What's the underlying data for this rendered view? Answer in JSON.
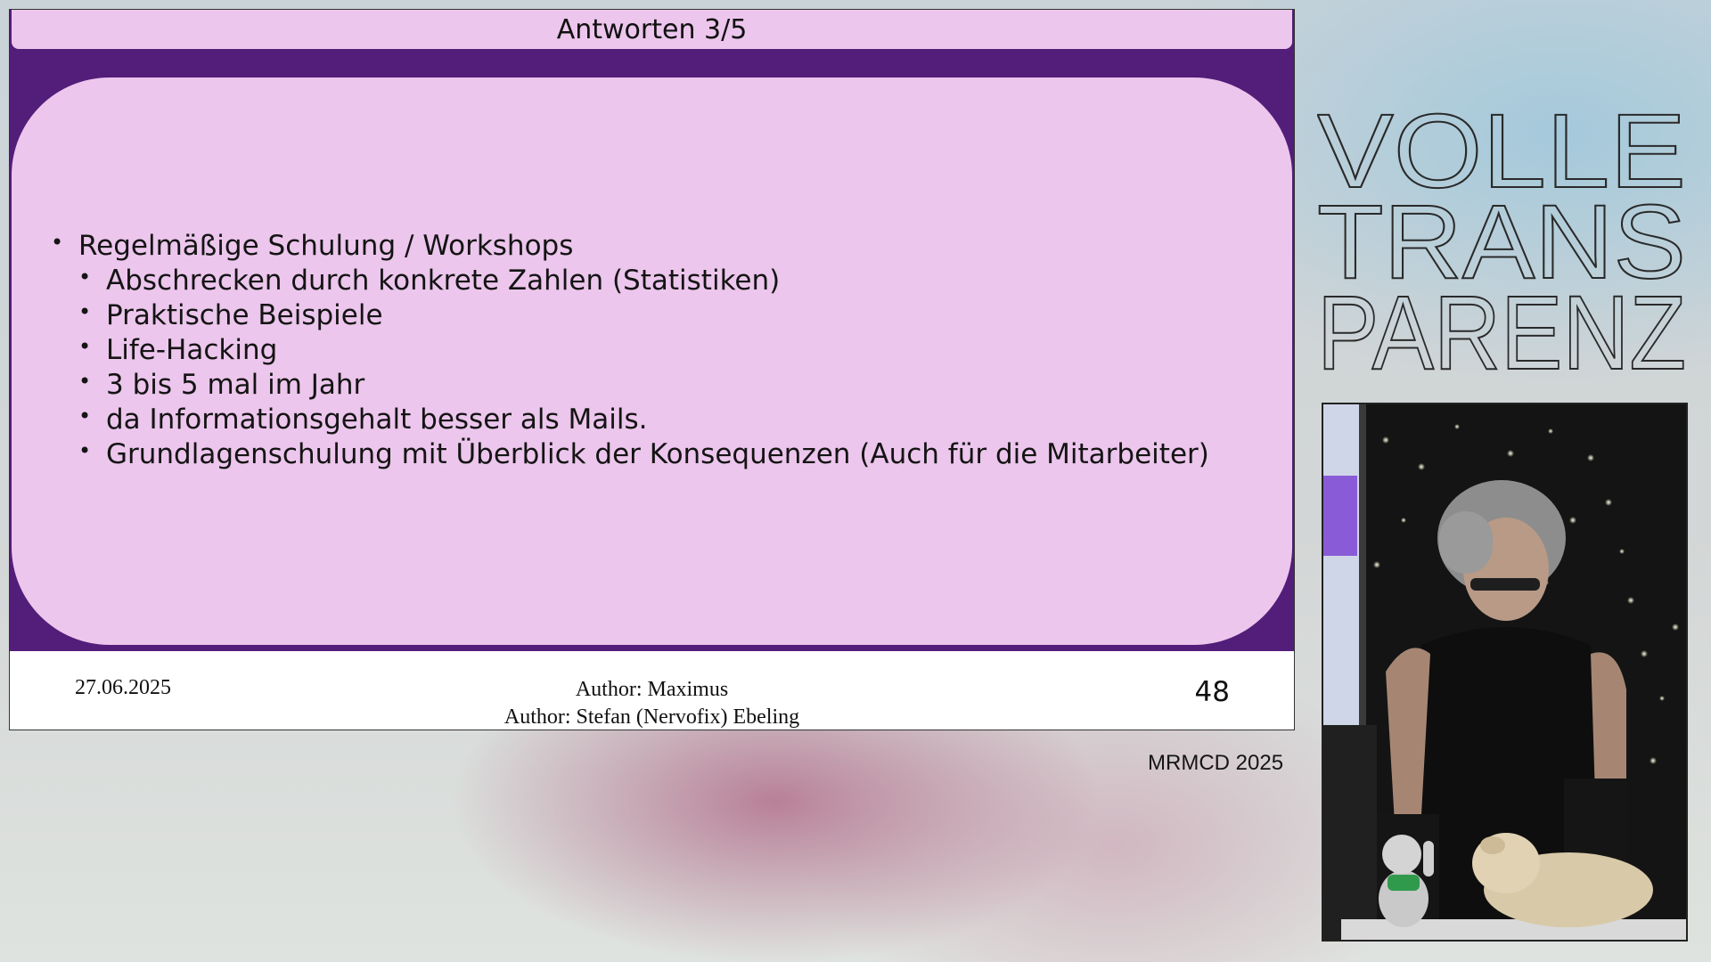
{
  "slide": {
    "title": "Antworten 3/5",
    "bullets": [
      {
        "level": 1,
        "text": "Regelmäßige Schulung / Workshops"
      },
      {
        "level": 2,
        "text": "Abschrecken durch konkrete Zahlen (Statistiken)"
      },
      {
        "level": 2,
        "text": "Praktische Beispiele"
      },
      {
        "level": 2,
        "text": "Life-Hacking"
      },
      {
        "level": 2,
        "text": "3 bis 5 mal im Jahr"
      },
      {
        "level": 2,
        "text": "da Informationsgehalt besser als Mails."
      },
      {
        "level": 2,
        "text": "Grundlagenschulung mit Überblick der Konsequenzen (Auch für die Mitarbeiter)"
      }
    ],
    "footer": {
      "date": "27.06.2025",
      "author_1": "Author: Maximus",
      "author_2": "Author: Stefan (Nervofix) Ebeling",
      "page_number": "48"
    }
  },
  "event_label": "MRMCD 2025",
  "logo": {
    "line_1": "VOLLE",
    "line_2": "TRANS",
    "line_3": "PARENZ"
  },
  "colors": {
    "slide_purple": "#531d7a",
    "slide_pink": "#ecc6ec"
  }
}
